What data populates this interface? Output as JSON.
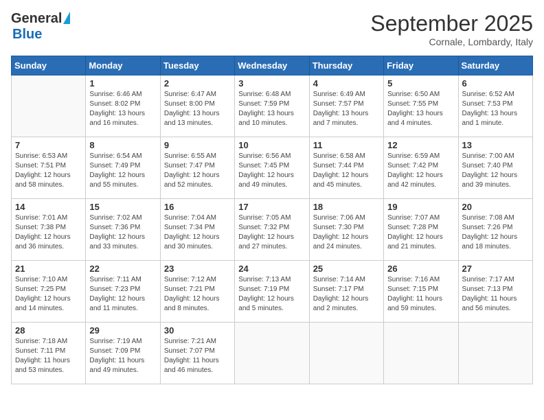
{
  "logo": {
    "general": "General",
    "blue": "Blue"
  },
  "header": {
    "month": "September 2025",
    "location": "Cornale, Lombardy, Italy"
  },
  "weekdays": [
    "Sunday",
    "Monday",
    "Tuesday",
    "Wednesday",
    "Thursday",
    "Friday",
    "Saturday"
  ],
  "weeks": [
    [
      {
        "day": "",
        "sunrise": "",
        "sunset": "",
        "daylight": ""
      },
      {
        "day": "1",
        "sunrise": "Sunrise: 6:46 AM",
        "sunset": "Sunset: 8:02 PM",
        "daylight": "Daylight: 13 hours and 16 minutes."
      },
      {
        "day": "2",
        "sunrise": "Sunrise: 6:47 AM",
        "sunset": "Sunset: 8:00 PM",
        "daylight": "Daylight: 13 hours and 13 minutes."
      },
      {
        "day": "3",
        "sunrise": "Sunrise: 6:48 AM",
        "sunset": "Sunset: 7:59 PM",
        "daylight": "Daylight: 13 hours and 10 minutes."
      },
      {
        "day": "4",
        "sunrise": "Sunrise: 6:49 AM",
        "sunset": "Sunset: 7:57 PM",
        "daylight": "Daylight: 13 hours and 7 minutes."
      },
      {
        "day": "5",
        "sunrise": "Sunrise: 6:50 AM",
        "sunset": "Sunset: 7:55 PM",
        "daylight": "Daylight: 13 hours and 4 minutes."
      },
      {
        "day": "6",
        "sunrise": "Sunrise: 6:52 AM",
        "sunset": "Sunset: 7:53 PM",
        "daylight": "Daylight: 13 hours and 1 minute."
      }
    ],
    [
      {
        "day": "7",
        "sunrise": "Sunrise: 6:53 AM",
        "sunset": "Sunset: 7:51 PM",
        "daylight": "Daylight: 12 hours and 58 minutes."
      },
      {
        "day": "8",
        "sunrise": "Sunrise: 6:54 AM",
        "sunset": "Sunset: 7:49 PM",
        "daylight": "Daylight: 12 hours and 55 minutes."
      },
      {
        "day": "9",
        "sunrise": "Sunrise: 6:55 AM",
        "sunset": "Sunset: 7:47 PM",
        "daylight": "Daylight: 12 hours and 52 minutes."
      },
      {
        "day": "10",
        "sunrise": "Sunrise: 6:56 AM",
        "sunset": "Sunset: 7:45 PM",
        "daylight": "Daylight: 12 hours and 49 minutes."
      },
      {
        "day": "11",
        "sunrise": "Sunrise: 6:58 AM",
        "sunset": "Sunset: 7:44 PM",
        "daylight": "Daylight: 12 hours and 45 minutes."
      },
      {
        "day": "12",
        "sunrise": "Sunrise: 6:59 AM",
        "sunset": "Sunset: 7:42 PM",
        "daylight": "Daylight: 12 hours and 42 minutes."
      },
      {
        "day": "13",
        "sunrise": "Sunrise: 7:00 AM",
        "sunset": "Sunset: 7:40 PM",
        "daylight": "Daylight: 12 hours and 39 minutes."
      }
    ],
    [
      {
        "day": "14",
        "sunrise": "Sunrise: 7:01 AM",
        "sunset": "Sunset: 7:38 PM",
        "daylight": "Daylight: 12 hours and 36 minutes."
      },
      {
        "day": "15",
        "sunrise": "Sunrise: 7:02 AM",
        "sunset": "Sunset: 7:36 PM",
        "daylight": "Daylight: 12 hours and 33 minutes."
      },
      {
        "day": "16",
        "sunrise": "Sunrise: 7:04 AM",
        "sunset": "Sunset: 7:34 PM",
        "daylight": "Daylight: 12 hours and 30 minutes."
      },
      {
        "day": "17",
        "sunrise": "Sunrise: 7:05 AM",
        "sunset": "Sunset: 7:32 PM",
        "daylight": "Daylight: 12 hours and 27 minutes."
      },
      {
        "day": "18",
        "sunrise": "Sunrise: 7:06 AM",
        "sunset": "Sunset: 7:30 PM",
        "daylight": "Daylight: 12 hours and 24 minutes."
      },
      {
        "day": "19",
        "sunrise": "Sunrise: 7:07 AM",
        "sunset": "Sunset: 7:28 PM",
        "daylight": "Daylight: 12 hours and 21 minutes."
      },
      {
        "day": "20",
        "sunrise": "Sunrise: 7:08 AM",
        "sunset": "Sunset: 7:26 PM",
        "daylight": "Daylight: 12 hours and 18 minutes."
      }
    ],
    [
      {
        "day": "21",
        "sunrise": "Sunrise: 7:10 AM",
        "sunset": "Sunset: 7:25 PM",
        "daylight": "Daylight: 12 hours and 14 minutes."
      },
      {
        "day": "22",
        "sunrise": "Sunrise: 7:11 AM",
        "sunset": "Sunset: 7:23 PM",
        "daylight": "Daylight: 12 hours and 11 minutes."
      },
      {
        "day": "23",
        "sunrise": "Sunrise: 7:12 AM",
        "sunset": "Sunset: 7:21 PM",
        "daylight": "Daylight: 12 hours and 8 minutes."
      },
      {
        "day": "24",
        "sunrise": "Sunrise: 7:13 AM",
        "sunset": "Sunset: 7:19 PM",
        "daylight": "Daylight: 12 hours and 5 minutes."
      },
      {
        "day": "25",
        "sunrise": "Sunrise: 7:14 AM",
        "sunset": "Sunset: 7:17 PM",
        "daylight": "Daylight: 12 hours and 2 minutes."
      },
      {
        "day": "26",
        "sunrise": "Sunrise: 7:16 AM",
        "sunset": "Sunset: 7:15 PM",
        "daylight": "Daylight: 11 hours and 59 minutes."
      },
      {
        "day": "27",
        "sunrise": "Sunrise: 7:17 AM",
        "sunset": "Sunset: 7:13 PM",
        "daylight": "Daylight: 11 hours and 56 minutes."
      }
    ],
    [
      {
        "day": "28",
        "sunrise": "Sunrise: 7:18 AM",
        "sunset": "Sunset: 7:11 PM",
        "daylight": "Daylight: 11 hours and 53 minutes."
      },
      {
        "day": "29",
        "sunrise": "Sunrise: 7:19 AM",
        "sunset": "Sunset: 7:09 PM",
        "daylight": "Daylight: 11 hours and 49 minutes."
      },
      {
        "day": "30",
        "sunrise": "Sunrise: 7:21 AM",
        "sunset": "Sunset: 7:07 PM",
        "daylight": "Daylight: 11 hours and 46 minutes."
      },
      {
        "day": "",
        "sunrise": "",
        "sunset": "",
        "daylight": ""
      },
      {
        "day": "",
        "sunrise": "",
        "sunset": "",
        "daylight": ""
      },
      {
        "day": "",
        "sunrise": "",
        "sunset": "",
        "daylight": ""
      },
      {
        "day": "",
        "sunrise": "",
        "sunset": "",
        "daylight": ""
      }
    ]
  ]
}
